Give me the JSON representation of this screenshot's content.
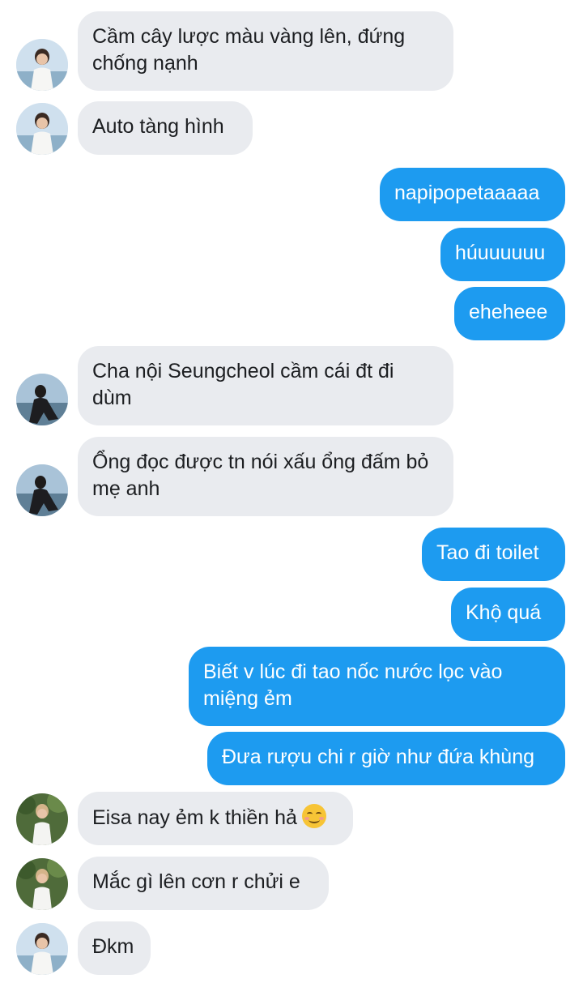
{
  "messages": [
    {
      "side": "in",
      "avatar": "avatar-boy-white-shirt",
      "text": "Cầm cây lược màu vàng lên, đứng chống nạnh"
    },
    {
      "side": "in",
      "avatar": "avatar-boy-white-shirt",
      "text": "Auto tàng hình"
    },
    {
      "side": "out",
      "text": "napipopetaaaaa"
    },
    {
      "side": "out",
      "text": "húuuuuuu"
    },
    {
      "side": "out",
      "text": "eheheee"
    },
    {
      "side": "in",
      "avatar": "avatar-sitting-dark",
      "text": "Cha nội Seungcheol cầm cái đt đi dùm"
    },
    {
      "side": "in",
      "avatar": "avatar-sitting-dark",
      "text": "Ổng đọc được tn nói xấu ổng đấm bỏ mẹ anh"
    },
    {
      "side": "out",
      "text": "Tao đi toilet"
    },
    {
      "side": "out",
      "text": "Khộ quá"
    },
    {
      "side": "out",
      "text": "Biết v lúc đi tao nốc nước lọc vào miệng ẻm"
    },
    {
      "side": "out",
      "text": "Đưa rượu chi r giờ như đứa khùng"
    },
    {
      "side": "in",
      "avatar": "avatar-boy-outdoor-green",
      "text": "Eisa nay ẻm k thiền hả",
      "emoji": "smiling-face-icon"
    },
    {
      "side": "in",
      "avatar": "avatar-boy-outdoor-green",
      "text": "Mắc gì lên cơn r chửi e"
    },
    {
      "side": "in",
      "avatar": "avatar-boy-white-shirt",
      "text": "Đkm"
    }
  ],
  "colors": {
    "incoming_bubble": "#e9ebef",
    "outgoing_bubble": "#1d9bf0",
    "incoming_text": "#1c1e21",
    "outgoing_text": "#ffffff"
  }
}
